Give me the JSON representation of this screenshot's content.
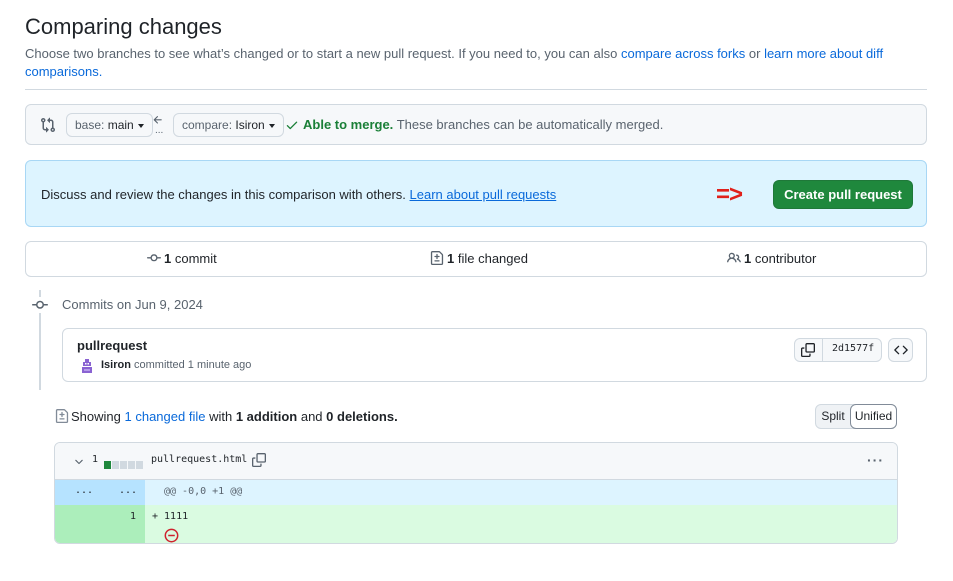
{
  "header": {
    "title": "Comparing changes",
    "subtitle_text": "Choose two branches to see what’s changed or to start a new pull request. If you need to, you can also",
    "compare_forks_link": "compare across forks",
    "or_text": "or",
    "learn_diff_link": "learn more about diff comparisons."
  },
  "range": {
    "base_label": "base:",
    "base_value": "main",
    "compare_label": "compare:",
    "compare_value": "Isiron",
    "dots": "...",
    "merge_status": "Able to merge.",
    "merge_detail": "These branches can be automatically merged."
  },
  "pull_request": {
    "discuss_text": "Discuss and review the changes in this comparison with others.",
    "learn_link": "Learn about pull requests",
    "arrow_annotation": "=>",
    "create_button": "Create pull request"
  },
  "summary": {
    "commits_count": "1",
    "commits_label": "commit",
    "files_count": "1",
    "files_label": "file changed",
    "contributors_count": "1",
    "contributors_label": "contributor"
  },
  "commits": {
    "group_date": "Commits on Jun 9, 2024",
    "items": [
      {
        "title": "pullrequest",
        "author": "Isiron",
        "meta": "committed 1 minute ago",
        "sha": "2d1577f"
      }
    ]
  },
  "diff_toolbar": {
    "showing": "Showing",
    "changed_files_link": "1 changed file",
    "with": "with",
    "additions": "1 addition",
    "and": "and",
    "deletions": "0 deletions.",
    "split_label": "Split",
    "unified_label": "Unified"
  },
  "file_diff": {
    "change_count": "1",
    "diffstat_added_blocks": 1,
    "diffstat_total_blocks": 5,
    "file_name": "pullrequest.html",
    "hunk_left_dots": "...",
    "hunk_right_dots": "...",
    "hunk_header": "@@ -0,0 +1 @@",
    "added_line_number": "1",
    "added_line_text": "+ 1111",
    "kebab": "···"
  },
  "colors": {
    "accent": "#0969da",
    "success": "#1a7f37",
    "primary_button": "#1f883d",
    "annotation_arrow": "#e0201a",
    "addition_bg": "#dafbe1",
    "hunk_bg": "#ddf4ff"
  },
  "icons": {
    "range": "git-compare-icon",
    "swap": "arrow-left-icon",
    "merge_ok": "check-icon",
    "commits": "git-commit-icon",
    "files": "file-diff-icon",
    "contributors": "people-icon",
    "copy": "copy-icon",
    "browse": "code-icon",
    "collapse": "chevron-down-icon",
    "no_newline": "no-entry-icon"
  }
}
